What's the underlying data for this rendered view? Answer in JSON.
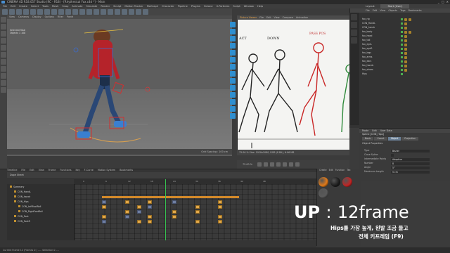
{
  "window": {
    "title": "CINEMA 4D R18.057 Studio (RC - R18) - [Rhythmical Fox.c4d *] - Main",
    "controls": [
      "_",
      "□",
      "×"
    ]
  },
  "menubar": [
    "File",
    "Edit",
    "Create",
    "Select",
    "Tools",
    "Mesh",
    "Snap",
    "Animate",
    "Simulate",
    "Render",
    "Sculpt",
    "Motion Tracker",
    "MoGraph",
    "Character",
    "Pipeline",
    "Plugins",
    "Octane",
    "X-Particles",
    "Script",
    "Window",
    "Help"
  ],
  "layout": {
    "label": "Layout:",
    "value": "Start (User)",
    "items": [
      "Layout:",
      "Start (User)"
    ]
  },
  "viewport1": {
    "menu": [
      "View",
      "Cameras",
      "Display",
      "Options",
      "Filter",
      "Panel"
    ],
    "info": [
      "Selected Total",
      "Objects  1   108"
    ],
    "status_left": "",
    "zoom": "Grid Spacing : 100 cm"
  },
  "viewport2": {
    "menu": [
      "File",
      "Edit",
      "View",
      "Compare",
      "Animation"
    ],
    "tab": "Picture Viewer",
    "status": "75.00 %   Size: 1920x1080, RGB (8 Bit), 6.06 MB",
    "zoom_pct": "75.00 %",
    "sketch_labels": [
      "ACT",
      "DOWN",
      "PASS POS"
    ]
  },
  "object_manager": {
    "header": [
      "File",
      "Edit",
      "View",
      "Objects",
      "Tags",
      "Bookmarks"
    ],
    "rows": [
      "fox_rig",
      "CON_HandL",
      "CON_handr",
      "fox_body",
      "fox_head",
      "fox_tail",
      "fox_eyeL",
      "fox_eyeR",
      "fox_legs",
      "fox_arms",
      "fox_ears",
      "fox_hands",
      "fox_shoes",
      "Hips"
    ]
  },
  "attribute_manager": {
    "header": [
      "Mode",
      "Edit",
      "User Data"
    ],
    "object": "Spline [CON_Hips]",
    "tabs": [
      "Basic",
      "Coord.",
      "Object",
      "Projection"
    ],
    "active_tab": "Object",
    "section": "Object Properties",
    "fields": [
      {
        "label": "Type",
        "value": "Bezier"
      },
      {
        "label": "Close Spline",
        "value": ""
      },
      {
        "label": "Intermediate Points",
        "value": "Adaptive"
      },
      {
        "label": "Number",
        "value": "8"
      },
      {
        "label": "Angle",
        "value": "5°"
      },
      {
        "label": "Maximum Length",
        "value": "5 cm"
      }
    ]
  },
  "timeline": {
    "title": "Timeline",
    "menu": [
      "File",
      "Edit",
      "View",
      "Frame",
      "Functions",
      "Key",
      "F-Curve",
      "Motion System",
      "Bookmarks"
    ],
    "mode": "Dope Sheet",
    "tracks": [
      "Summary",
      "CON_HandL",
      "CON_handr",
      "CON_Hips",
      "CON_LeftFootRoll",
      "CON_RightFootRoll",
      "CON_Foot",
      "CON_FootR"
    ],
    "ruler_ticks": [
      "0",
      "6",
      "12",
      "18",
      "24",
      "30",
      "36",
      "42",
      "48"
    ],
    "current_frame": 12
  },
  "material_manager": {
    "header": [
      "Create",
      "Edit",
      "Function",
      "Tex"
    ],
    "materials": [
      {
        "color": "#e07a1a"
      },
      {
        "color": "#1e1e1e"
      },
      {
        "color": "#c02525"
      },
      {
        "color": "#5a5a5a"
      }
    ]
  },
  "overlay": {
    "title": "UP",
    "sep": ":",
    "frame": "12frame",
    "line1": "Hips를 가장 높게, 왼발 조금 들고",
    "line2": "전체 키프레임 (F9)"
  },
  "status": {
    "text": "Current Frame  12  (Frames  0 )  .....  Selection  0  ...."
  },
  "colors": {
    "accent_key": "#e3a94a",
    "playhead": "#36c24f",
    "tool_blue": "#2f8fd0"
  }
}
